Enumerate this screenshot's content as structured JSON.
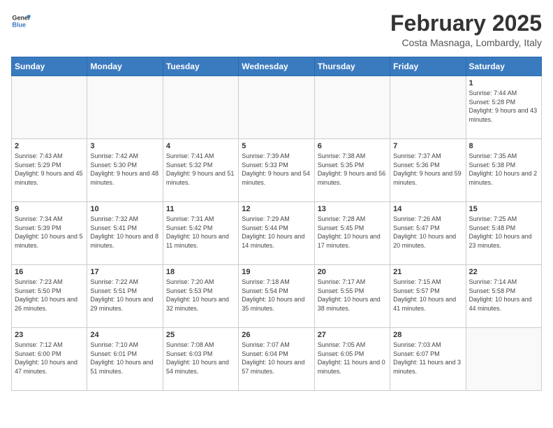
{
  "header": {
    "logo_general": "General",
    "logo_blue": "Blue",
    "title": "February 2025",
    "subtitle": "Costa Masnaga, Lombardy, Italy"
  },
  "weekdays": [
    "Sunday",
    "Monday",
    "Tuesday",
    "Wednesday",
    "Thursday",
    "Friday",
    "Saturday"
  ],
  "weeks": [
    [
      {
        "day": "",
        "info": ""
      },
      {
        "day": "",
        "info": ""
      },
      {
        "day": "",
        "info": ""
      },
      {
        "day": "",
        "info": ""
      },
      {
        "day": "",
        "info": ""
      },
      {
        "day": "",
        "info": ""
      },
      {
        "day": "1",
        "info": "Sunrise: 7:44 AM\nSunset: 5:28 PM\nDaylight: 9 hours and 43 minutes."
      }
    ],
    [
      {
        "day": "2",
        "info": "Sunrise: 7:43 AM\nSunset: 5:29 PM\nDaylight: 9 hours and 45 minutes."
      },
      {
        "day": "3",
        "info": "Sunrise: 7:42 AM\nSunset: 5:30 PM\nDaylight: 9 hours and 48 minutes."
      },
      {
        "day": "4",
        "info": "Sunrise: 7:41 AM\nSunset: 5:32 PM\nDaylight: 9 hours and 51 minutes."
      },
      {
        "day": "5",
        "info": "Sunrise: 7:39 AM\nSunset: 5:33 PM\nDaylight: 9 hours and 54 minutes."
      },
      {
        "day": "6",
        "info": "Sunrise: 7:38 AM\nSunset: 5:35 PM\nDaylight: 9 hours and 56 minutes."
      },
      {
        "day": "7",
        "info": "Sunrise: 7:37 AM\nSunset: 5:36 PM\nDaylight: 9 hours and 59 minutes."
      },
      {
        "day": "8",
        "info": "Sunrise: 7:35 AM\nSunset: 5:38 PM\nDaylight: 10 hours and 2 minutes."
      }
    ],
    [
      {
        "day": "9",
        "info": "Sunrise: 7:34 AM\nSunset: 5:39 PM\nDaylight: 10 hours and 5 minutes."
      },
      {
        "day": "10",
        "info": "Sunrise: 7:32 AM\nSunset: 5:41 PM\nDaylight: 10 hours and 8 minutes."
      },
      {
        "day": "11",
        "info": "Sunrise: 7:31 AM\nSunset: 5:42 PM\nDaylight: 10 hours and 11 minutes."
      },
      {
        "day": "12",
        "info": "Sunrise: 7:29 AM\nSunset: 5:44 PM\nDaylight: 10 hours and 14 minutes."
      },
      {
        "day": "13",
        "info": "Sunrise: 7:28 AM\nSunset: 5:45 PM\nDaylight: 10 hours and 17 minutes."
      },
      {
        "day": "14",
        "info": "Sunrise: 7:26 AM\nSunset: 5:47 PM\nDaylight: 10 hours and 20 minutes."
      },
      {
        "day": "15",
        "info": "Sunrise: 7:25 AM\nSunset: 5:48 PM\nDaylight: 10 hours and 23 minutes."
      }
    ],
    [
      {
        "day": "16",
        "info": "Sunrise: 7:23 AM\nSunset: 5:50 PM\nDaylight: 10 hours and 26 minutes."
      },
      {
        "day": "17",
        "info": "Sunrise: 7:22 AM\nSunset: 5:51 PM\nDaylight: 10 hours and 29 minutes."
      },
      {
        "day": "18",
        "info": "Sunrise: 7:20 AM\nSunset: 5:53 PM\nDaylight: 10 hours and 32 minutes."
      },
      {
        "day": "19",
        "info": "Sunrise: 7:18 AM\nSunset: 5:54 PM\nDaylight: 10 hours and 35 minutes."
      },
      {
        "day": "20",
        "info": "Sunrise: 7:17 AM\nSunset: 5:55 PM\nDaylight: 10 hours and 38 minutes."
      },
      {
        "day": "21",
        "info": "Sunrise: 7:15 AM\nSunset: 5:57 PM\nDaylight: 10 hours and 41 minutes."
      },
      {
        "day": "22",
        "info": "Sunrise: 7:14 AM\nSunset: 5:58 PM\nDaylight: 10 hours and 44 minutes."
      }
    ],
    [
      {
        "day": "23",
        "info": "Sunrise: 7:12 AM\nSunset: 6:00 PM\nDaylight: 10 hours and 47 minutes."
      },
      {
        "day": "24",
        "info": "Sunrise: 7:10 AM\nSunset: 6:01 PM\nDaylight: 10 hours and 51 minutes."
      },
      {
        "day": "25",
        "info": "Sunrise: 7:08 AM\nSunset: 6:03 PM\nDaylight: 10 hours and 54 minutes."
      },
      {
        "day": "26",
        "info": "Sunrise: 7:07 AM\nSunset: 6:04 PM\nDaylight: 10 hours and 57 minutes."
      },
      {
        "day": "27",
        "info": "Sunrise: 7:05 AM\nSunset: 6:05 PM\nDaylight: 11 hours and 0 minutes."
      },
      {
        "day": "28",
        "info": "Sunrise: 7:03 AM\nSunset: 6:07 PM\nDaylight: 11 hours and 3 minutes."
      },
      {
        "day": "",
        "info": ""
      }
    ]
  ]
}
